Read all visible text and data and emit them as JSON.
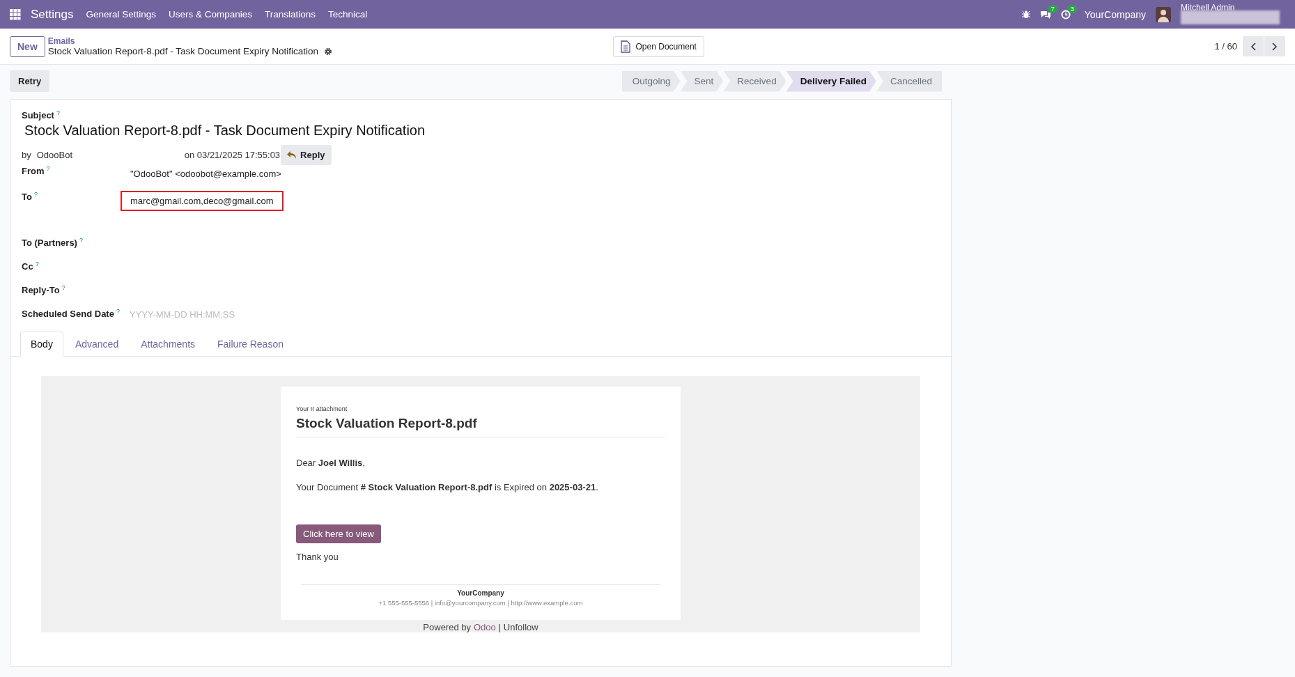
{
  "navbar": {
    "app": "Settings",
    "menus": [
      "General Settings",
      "Users & Companies",
      "Translations",
      "Technical"
    ],
    "chat_count": "7",
    "activity_count": "3",
    "company": "YourCompany",
    "user": "Mitchell Admin"
  },
  "control_panel": {
    "new_button": "New",
    "breadcrumb": "Emails",
    "record_title": "Stock Valuation Report-8.pdf - Task Document Expiry Notification",
    "open_document": "Open Document",
    "pager": "1 / 60"
  },
  "retry_button": "Retry",
  "status_bar": [
    {
      "label": "Outgoing",
      "selected": false
    },
    {
      "label": "Sent",
      "selected": false
    },
    {
      "label": "Received",
      "selected": false
    },
    {
      "label": "Delivery Failed",
      "selected": true
    },
    {
      "label": "Cancelled",
      "selected": false
    }
  ],
  "form": {
    "subject_label": "Subject",
    "subject_help": "?",
    "subject": "Stock Valuation Report-8.pdf - Task Document Expiry Notification",
    "author_prefix": "by",
    "author": "OdooBot",
    "date": "on 03/21/2025 17:55:03",
    "reply_button": "Reply",
    "fields": [
      {
        "label": "From",
        "help": "?",
        "value": "\"OdooBot\" <odoobot@example.com>"
      },
      {
        "label": "To",
        "help": "?",
        "value": "marc@gmail.com,deco@gmail.com",
        "highlighted": true
      },
      {
        "label": "To (Partners)",
        "help": "?"
      },
      {
        "label": "Cc",
        "help": "?"
      },
      {
        "label": "Reply-To",
        "help": "?"
      },
      {
        "label": "Scheduled Send Date",
        "help": "?",
        "placeholder": "YYYY-MM-DD HH:MM:SS"
      }
    ]
  },
  "tabs": [
    {
      "label": "Body",
      "selected": true
    },
    {
      "label": "Advanced",
      "selected": false
    },
    {
      "label": "Attachments",
      "selected": false
    },
    {
      "label": "Failure Reason",
      "selected": false
    }
  ],
  "email": {
    "kicker": "Your Ir attachment",
    "heading": "Stock Valuation Report-8.pdf",
    "greeting": "Dear **Joel Willis**,",
    "message": "Your Document **# Stock Valuation Report-8.pdf** is Expired on **2025-03-21**.",
    "button": "Click here to view",
    "closing": "Thank you",
    "company": "YourCompany",
    "contact": "+1 555-555-5556 | info@yourcompany.com | http://www.example.com",
    "footer_prefix": "Powered by",
    "footer_link": "Odoo",
    "footer_suffix": "| Unfollow"
  }
}
